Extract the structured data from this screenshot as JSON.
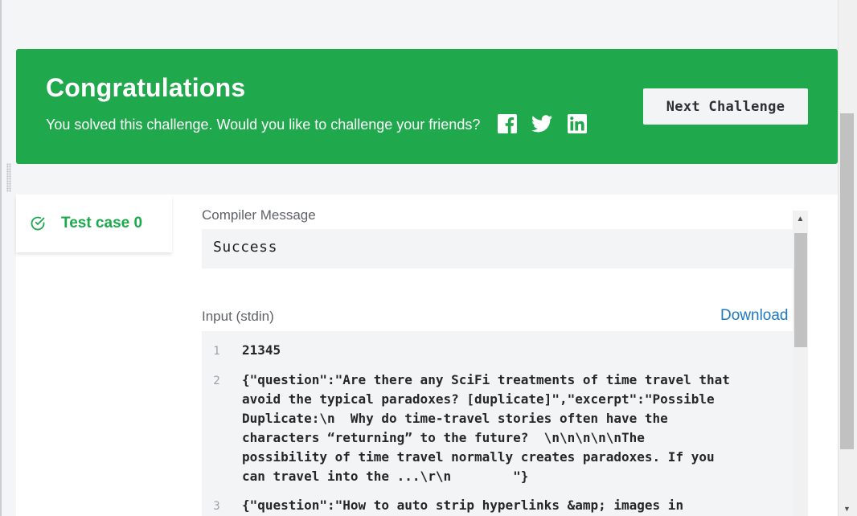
{
  "banner": {
    "title": "Congratulations",
    "message": "You solved this challenge. Would you like to challenge your friends?",
    "next_button": "Next Challenge",
    "social": [
      "facebook-icon",
      "twitter-icon",
      "linkedin-icon"
    ]
  },
  "results": {
    "test_case_label": "Test case 0",
    "compiler_message_label": "Compiler Message",
    "compiler_message": "Success",
    "input_label": "Input (stdin)",
    "download_label": "Download",
    "input_lines": [
      {
        "num": "1",
        "text": "21345"
      },
      {
        "num": "2",
        "text": "{\"question\":\"Are there any SciFi treatments of time travel that\navoid the typical paradoxes? [duplicate]\",\"excerpt\":\"Possible\nDuplicate:\\n  Why do time-travel stories often have the\ncharacters “returning” to the future?  \\n\\n\\n\\n\\nThe\npossibility of time travel normally creates paradoxes. If you\ncan travel into the ...\\r\\n        \"}"
      },
      {
        "num": "3",
        "text": "{\"question\":\"How to auto strip hyperlinks &amp; images in"
      }
    ]
  },
  "colors": {
    "success_green": "#20a94c",
    "link_blue": "#1f78c1"
  }
}
